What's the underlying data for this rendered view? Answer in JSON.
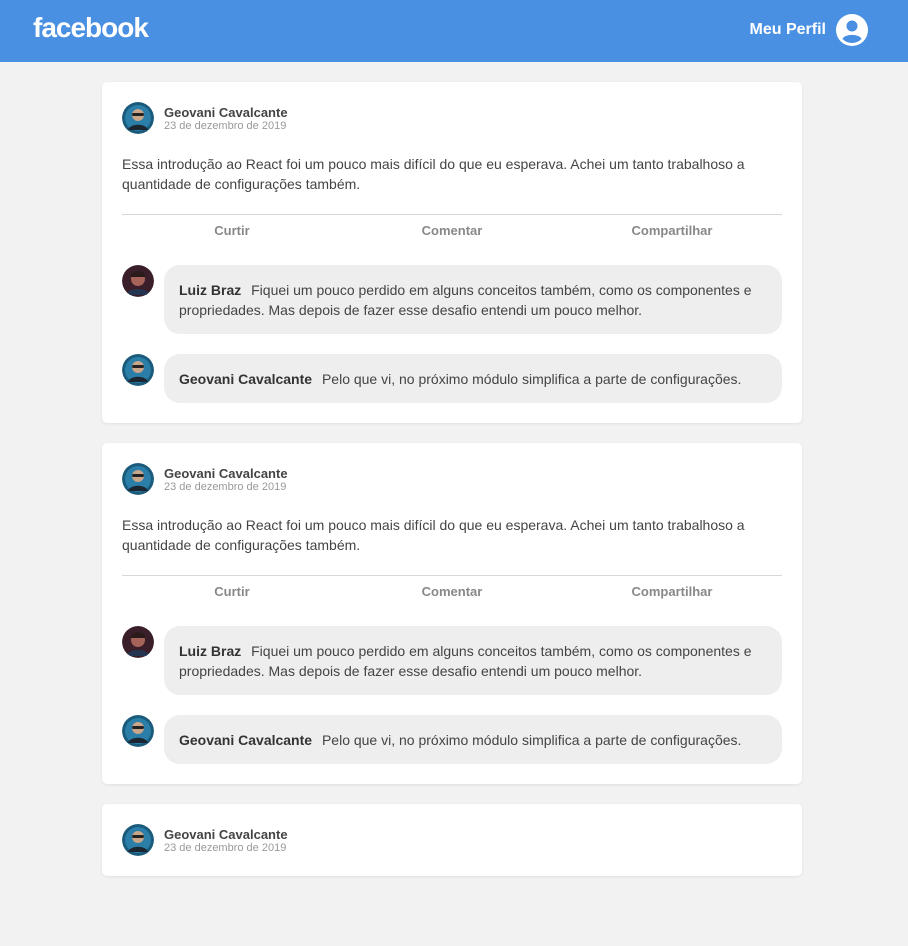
{
  "header": {
    "logo": "facebook",
    "profile_label": "Meu Perfil"
  },
  "posts": [
    {
      "author": "Geovani Cavalcante",
      "date": "23 de dezembro de 2019",
      "content": "Essa introdução ao React foi um pouco mais difícil do que eu esperava. Achei um tanto trabalhoso a quantidade de configurações também.",
      "actions": [
        "Curtir",
        "Comentar",
        "Compartilhar"
      ],
      "comments": [
        {
          "author": "Luiz Braz",
          "text": "Fiquei um pouco perdido em alguns conceitos também, como os componentes e propriedades. Mas depois de fazer esse desafio entendi um pouco melhor."
        },
        {
          "author": "Geovani Cavalcante",
          "text": "Pelo que vi, no próximo módulo simplifica a parte de configurações."
        }
      ]
    },
    {
      "author": "Geovani Cavalcante",
      "date": "23 de dezembro de 2019",
      "content": "Essa introdução ao React foi um pouco mais difícil do que eu esperava. Achei um tanto trabalhoso a quantidade de configurações também.",
      "actions": [
        "Curtir",
        "Comentar",
        "Compartilhar"
      ],
      "comments": [
        {
          "author": "Luiz Braz",
          "text": "Fiquei um pouco perdido em alguns conceitos também, como os componentes e propriedades. Mas depois de fazer esse desafio entendi um pouco melhor."
        },
        {
          "author": "Geovani Cavalcante",
          "text": "Pelo que vi, no próximo módulo simplifica a parte de configurações."
        }
      ]
    },
    {
      "author": "Geovani Cavalcante",
      "date": "23 de dezembro de 2019"
    }
  ],
  "colors": {
    "brand": "#4a90e2",
    "background": "#f2f2f2",
    "bubble": "#eeeeee"
  }
}
